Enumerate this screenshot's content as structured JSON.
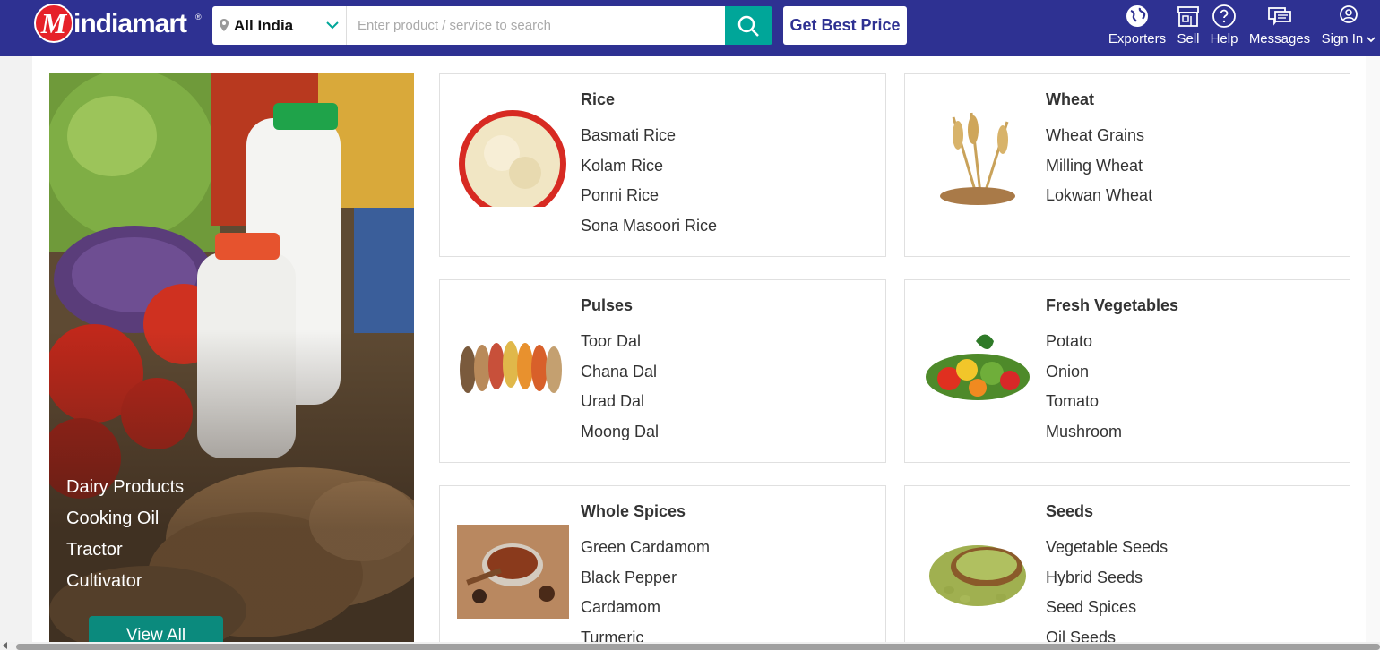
{
  "header": {
    "logo_text": "indiamart",
    "logo_letter": "M",
    "logo_reg": "®",
    "location": "All India",
    "search_placeholder": "Enter product / service to search",
    "best_price_label": "Get Best Price",
    "nav": [
      {
        "label": "Exporters",
        "icon": "globe-icon"
      },
      {
        "label": "Sell",
        "icon": "store-icon"
      },
      {
        "label": "Help",
        "icon": "help-icon"
      },
      {
        "label": "Messages",
        "icon": "messages-icon"
      },
      {
        "label": "Sign In",
        "icon": "user-icon"
      }
    ]
  },
  "hero": {
    "links": [
      "Dairy Products",
      "Cooking Oil",
      "Tractor",
      "Cultivator"
    ],
    "view_all": "View All"
  },
  "categories": [
    {
      "title": "Rice",
      "items": [
        "Basmati Rice",
        "Kolam Rice",
        "Ponni Rice",
        "Sona Masoori Rice"
      ],
      "image": "rice-bowl"
    },
    {
      "title": "Wheat",
      "items": [
        "Wheat Grains",
        "Milling Wheat",
        "Lokwan Wheat"
      ],
      "image": "wheat-stalks"
    },
    {
      "title": "Pulses",
      "items": [
        "Toor Dal",
        "Chana Dal",
        "Urad Dal",
        "Moong Dal"
      ],
      "image": "pulses-scoops"
    },
    {
      "title": "Fresh Vegetables",
      "items": [
        "Potato",
        "Onion",
        "Tomato",
        "Mushroom"
      ],
      "image": "vegetable-pile"
    },
    {
      "title": "Whole Spices",
      "items": [
        "Green Cardamom",
        "Black Pepper",
        "Cardamom",
        "Turmeric"
      ],
      "image": "spice-bowl"
    },
    {
      "title": "Seeds",
      "items": [
        "Vegetable Seeds",
        "Hybrid Seeds",
        "Seed Spices",
        "Oil Seeds"
      ],
      "image": "seeds-basket"
    }
  ],
  "colors": {
    "header_bg": "#2e3192",
    "search_button": "#00a699",
    "view_all_bg": "#0b8a7d",
    "logo_red": "#e62129"
  }
}
